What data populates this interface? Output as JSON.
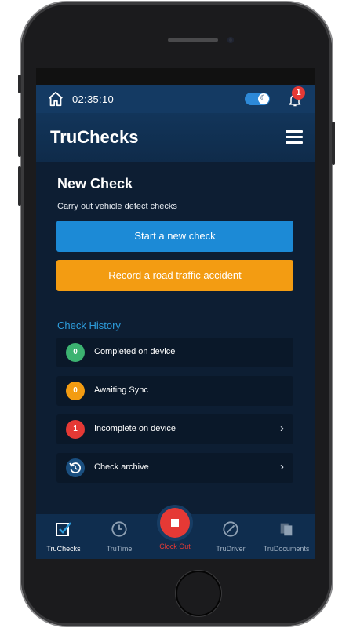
{
  "statusbar": {
    "time": "02:35:10",
    "notification_count": "1",
    "dark_mode_icon": "moon-icon"
  },
  "header": {
    "title": "TruChecks"
  },
  "new_check": {
    "title": "New Check",
    "description": "Carry out vehicle defect checks",
    "start_button": "Start a new check",
    "accident_button": "Record a road traffic accident"
  },
  "history": {
    "title": "Check History",
    "items": [
      {
        "count": "0",
        "label": "Completed on device",
        "color": "#3cb371",
        "chevron": false
      },
      {
        "count": "0",
        "label": "Awaiting Sync",
        "color": "#f39c12",
        "chevron": false
      },
      {
        "count": "1",
        "label": "Incomplete on device",
        "color": "#e53935",
        "chevron": true
      },
      {
        "count": "",
        "label": "Check archive",
        "color": "#1a4f80",
        "chevron": true,
        "icon": "history-icon"
      }
    ]
  },
  "nav": {
    "items": [
      {
        "label": "TruChecks",
        "icon": "checkbox-icon",
        "active": true
      },
      {
        "label": "TruTime",
        "icon": "clock-icon",
        "active": false
      },
      {
        "label": "Clock Out",
        "icon": "stop-icon",
        "active": false
      },
      {
        "label": "TruDriver",
        "icon": "steering-wheel-icon",
        "active": false
      },
      {
        "label": "TruDocuments",
        "icon": "documents-icon",
        "active": false
      }
    ]
  },
  "colors": {
    "primary_blue": "#1c8ad6",
    "accent_orange": "#f39c12",
    "danger_red": "#e53935",
    "success_green": "#3cb371",
    "background": "#0d1e33"
  }
}
